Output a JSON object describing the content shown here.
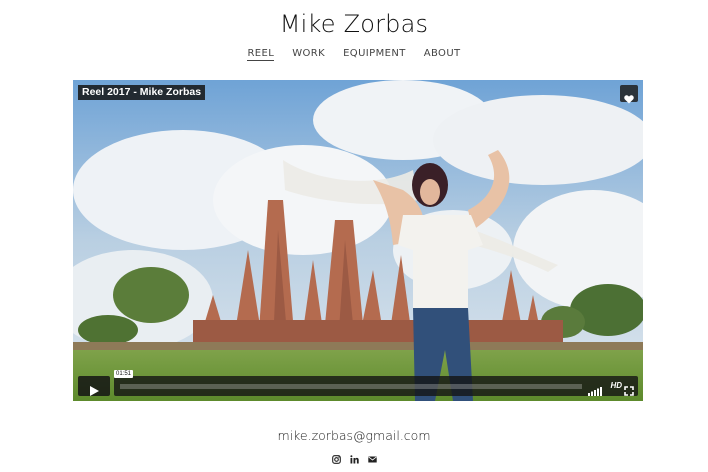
{
  "site": {
    "title": "Mike Zorbas"
  },
  "nav": [
    {
      "label": "REEL",
      "active": true
    },
    {
      "label": "WORK",
      "active": false
    },
    {
      "label": "EQUIPMENT",
      "active": false
    },
    {
      "label": "ABOUT",
      "active": false
    }
  ],
  "video": {
    "title": "Reel 2017 - Mike Zorbas",
    "time": "01:51",
    "quality": "HD",
    "progress": 0.0
  },
  "footer": {
    "email": "mike.zorbas@gmail.com",
    "social_icons": [
      "instagram-icon",
      "linkedin-icon",
      "envelope-icon"
    ]
  }
}
